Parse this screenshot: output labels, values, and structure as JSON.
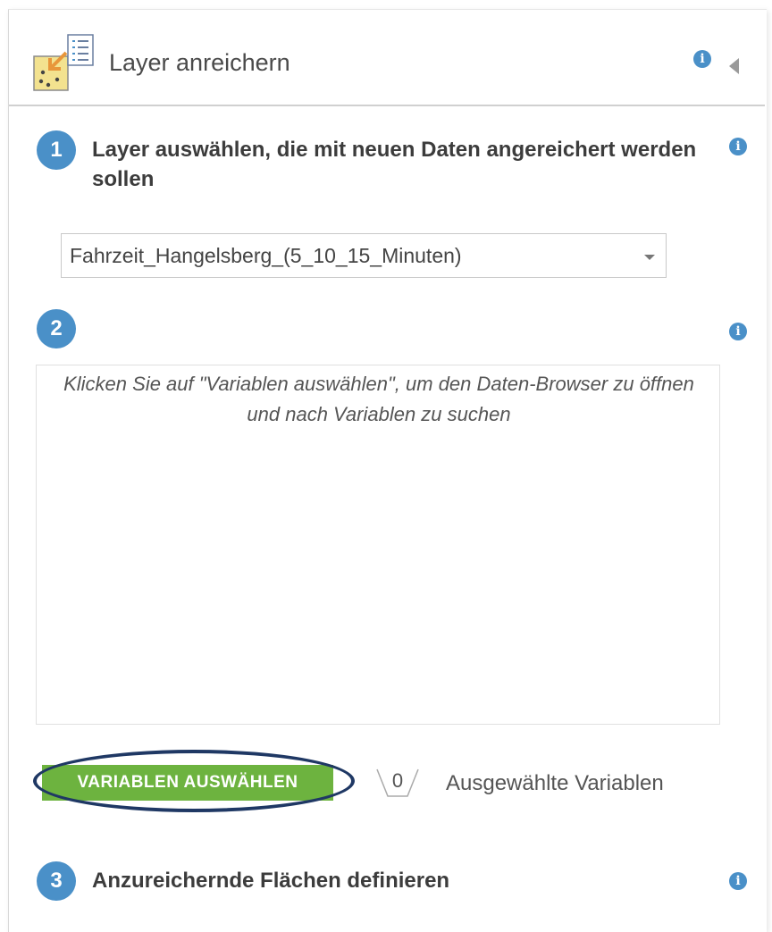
{
  "panel": {
    "title": "Layer anreichern",
    "icon": "enrich-layer-icon"
  },
  "steps": [
    {
      "number": "1",
      "label": "Layer auswählen, die mit neuen Daten angereichert werden sollen"
    },
    {
      "number": "2",
      "label": ""
    },
    {
      "number": "3",
      "label": "Anzureichernde Flächen definieren"
    }
  ],
  "layer_select": {
    "value": "Fahrzeit_Hangelsberg_(5_10_15_Minuten)"
  },
  "variables": {
    "hint": "Klicken Sie auf \"Variablen auswählen\", um den Daten-Browser zu öffnen und nach Variablen zu suchen",
    "button_label": "VARIABLEN AUSWÄHLEN",
    "count": "0",
    "count_label": "Ausgewählte Variablen"
  },
  "colors": {
    "accent": "#4a90c8",
    "button": "#6db33f",
    "highlight": "#1f3864"
  }
}
